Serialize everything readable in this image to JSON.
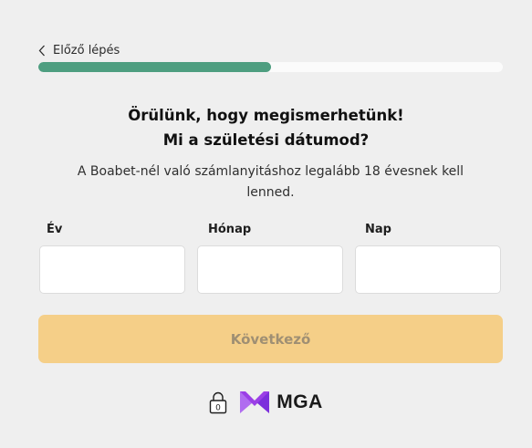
{
  "nav": {
    "back_label": "Előző lépés"
  },
  "progress": {
    "fraction": 0.5,
    "fill_color": "#4e9e80",
    "track_color": "#fbfbfb"
  },
  "heading": {
    "line1": "Örülünk, hogy megismerhetünk!",
    "line2": "Mi a születési dátumod?"
  },
  "subtitle": "A Boabet-nél való számlanyitáshoz legalább 18 évesnek kell lenned.",
  "fields": [
    {
      "label": "Év",
      "value": "",
      "placeholder": ""
    },
    {
      "label": "Hónap",
      "value": "",
      "placeholder": ""
    },
    {
      "label": "Nap",
      "value": "",
      "placeholder": ""
    }
  ],
  "next_button": {
    "label": "Következő",
    "background": "#f5cf88",
    "text_color": "#9f8f73",
    "disabled": true
  },
  "footer": {
    "lock_icon": "lock-icon",
    "brand_icon": "mga-logo-icon",
    "brand_text": "MGA",
    "brand_color": "#9b3fe6"
  }
}
